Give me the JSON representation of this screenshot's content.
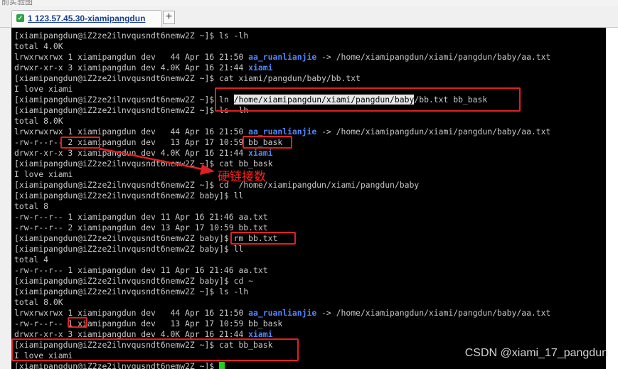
{
  "top_fragment": "前实验图",
  "tab": {
    "label": "1 123.57.45.30-xiamipangdun",
    "new_tab": "+"
  },
  "terminal": {
    "lines": [
      [
        {
          "t": "[xiamipangdun@iZ2ze2ilnvqusndt6nemw2Z ~]$ ls -lh"
        }
      ],
      [
        {
          "t": "total 4.0K"
        }
      ],
      [
        {
          "t": "lrwxrwxrwx 1 xiamipangdun dev   44 Apr 16 21:50 "
        },
        {
          "t": "aa_ruanlianjie",
          "c": "b"
        },
        {
          "t": " -> /home/xiamipangdun/xiami/pangdun/baby/aa.txt"
        }
      ],
      [
        {
          "t": "drwxr-xr-x 3 xiamipangdun dev 4.0K Apr 16 21:44 "
        },
        {
          "t": "xiami",
          "c": "b"
        }
      ],
      [
        {
          "t": "[xiamipangdun@iZ2ze2ilnvqusndt6nemw2Z ~]$ cat xiami/pangdun/baby/bb.txt"
        }
      ],
      [
        {
          "t": "I love xiami"
        }
      ],
      [
        {
          "t": "[xiamipangdun@iZ2ze2ilnvqusndt6nemw2Z ~]$ ln "
        },
        {
          "t": "/home/xiamipangdun/xiami/pangdun/baby",
          "c": "sel"
        },
        {
          "t": "/bb.txt bb_bask"
        }
      ],
      [
        {
          "t": "[xiamipangdun@iZ2ze2ilnvqusndt6nemw2Z ~]$ ls -lh"
        }
      ],
      [
        {
          "t": "total 8.0K"
        }
      ],
      [
        {
          "t": "lrwxrwxrwx 1 xiamipangdun dev   44 Apr 16 21:50 "
        },
        {
          "t": "aa_ruanlianjie",
          "c": "b"
        },
        {
          "t": " -> /home/xiamipangdun/xiami/pangdun/baby/aa.txt"
        }
      ],
      [
        {
          "t": "-rw-r--r-- 2 xiamipangdun dev   13 Apr 17 10:59 bb_bask"
        }
      ],
      [
        {
          "t": "drwxr-xr-x 3 xiamipangdun dev 4.0K Apr 16 21:44 "
        },
        {
          "t": "xiami",
          "c": "b"
        }
      ],
      [
        {
          "t": "[xiamipangdun@iZ2ze2ilnvqusndt6nemw2Z ~]$ cat bb_bask"
        }
      ],
      [
        {
          "t": "I love xiami"
        }
      ],
      [
        {
          "t": "[xiamipangdun@iZ2ze2ilnvqusndt6nemw2Z ~]$ cd  /home/xiamipangdun/xiami/pangdun/baby"
        }
      ],
      [
        {
          "t": "[xiamipangdun@iZ2ze2ilnvqusndt6nemw2Z baby]$ ll"
        }
      ],
      [
        {
          "t": "total 8"
        }
      ],
      [
        {
          "t": "-rw-r--r-- 1 xiamipangdun dev 11 Apr 16 21:46 aa.txt"
        }
      ],
      [
        {
          "t": "-rw-r--r-- 2 xiamipangdun dev 13 Apr 17 10:59 bb.txt"
        }
      ],
      [
        {
          "t": "[xiamipangdun@iZ2ze2ilnvqusndt6nemw2Z baby]$ rm bb.txt"
        }
      ],
      [
        {
          "t": "[xiamipangdun@iZ2ze2ilnvqusndt6nemw2Z baby]$ ll"
        }
      ],
      [
        {
          "t": "total 4"
        }
      ],
      [
        {
          "t": "-rw-r--r-- 1 xiamipangdun dev 11 Apr 16 21:46 aa.txt"
        }
      ],
      [
        {
          "t": "[xiamipangdun@iZ2ze2ilnvqusndt6nemw2Z baby]$ cd ~"
        }
      ],
      [
        {
          "t": "[xiamipangdun@iZ2ze2ilnvqusndt6nemw2Z ~]$ ls -lh"
        }
      ],
      [
        {
          "t": "total 8.0K"
        }
      ],
      [
        {
          "t": "lrwxrwxrwx 1 xiamipangdun dev   44 Apr 16 21:50 "
        },
        {
          "t": "aa_ruanlianjie",
          "c": "b"
        },
        {
          "t": " -> /home/xiamipangdun/xiami/pangdun/baby/aa.txt"
        }
      ],
      [
        {
          "t": "-rw-r--r-- 1 xiamipangdun dev   13 Apr 17 10:59 bb_bask"
        }
      ],
      [
        {
          "t": "drwxr-xr-x 3 xiamipangdun dev 4.0K Apr 16 21:44 "
        },
        {
          "t": "xiami",
          "c": "b"
        }
      ],
      [
        {
          "t": "[xiamipangdun@iZ2ze2ilnvqusndt6nemw2Z ~]$ cat bb_bask"
        }
      ],
      [
        {
          "t": "I love xiami"
        }
      ],
      [
        {
          "t": "[xiamipangdun@iZ2ze2ilnvqusndt6nemw2Z ~]$ "
        },
        {
          "cursor": true
        }
      ]
    ]
  },
  "annotation": {
    "text": "硬链接数"
  },
  "watermark": "CSDN @xiami_17_pangdun",
  "colors": {
    "highlight": "#e02020",
    "dir_link": "#4f88ff",
    "cursor": "#20d020"
  }
}
